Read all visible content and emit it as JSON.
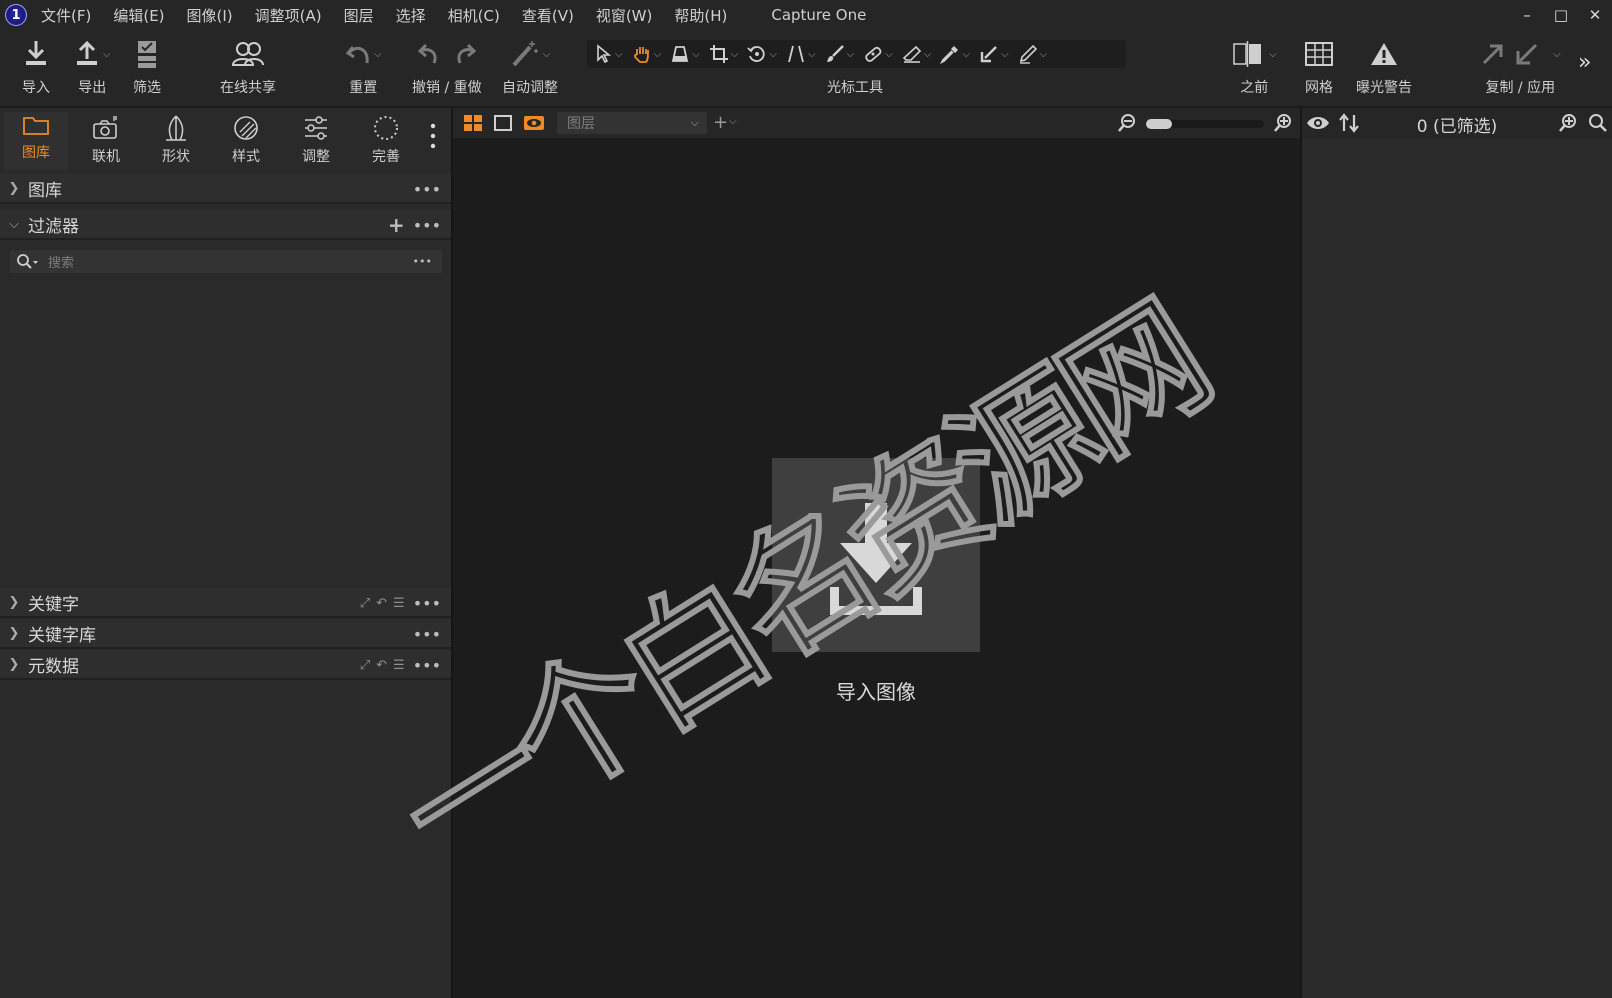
{
  "window": {
    "title": "Capture One",
    "logo_char": "1",
    "controls": {
      "minimize": "–",
      "maximize": "□",
      "close": "✕"
    }
  },
  "menu": [
    "文件(F)",
    "编辑(E)",
    "图像(I)",
    "调整项(A)",
    "图层",
    "选择",
    "相机(C)",
    "查看(V)",
    "视窗(W)",
    "帮助(H)"
  ],
  "toolbar": {
    "import": "导入",
    "export": "导出",
    "filter": "筛选",
    "share": "在线共享",
    "reset": "重置",
    "undo_redo": "撤销 / 重做",
    "auto_adjust": "自动调整",
    "cursor_tools": "光标工具",
    "before": "之前",
    "grid": "网格",
    "exposure_warning": "曝光警告",
    "copy_apply": "复制 / 应用",
    "more": "»"
  },
  "tool_tabs": [
    {
      "label": "图库",
      "icon": "folder-icon",
      "active": true
    },
    {
      "label": "联机",
      "icon": "camera-icon",
      "active": false
    },
    {
      "label": "形状",
      "icon": "lens-shape-icon",
      "active": false
    },
    {
      "label": "样式",
      "icon": "styles-icon",
      "active": false
    },
    {
      "label": "调整",
      "icon": "sliders-icon",
      "active": false
    },
    {
      "label": "完善",
      "icon": "refine-icon",
      "active": false
    }
  ],
  "sections": {
    "library": "图库",
    "filters": "过滤器",
    "keywords": "关键字",
    "keyword_library": "关键字库",
    "metadata": "元数据"
  },
  "search": {
    "placeholder": "搜索",
    "more": "•••"
  },
  "viewer": {
    "layer_select": "图层",
    "add_layer": "+",
    "import_label": "导入图像"
  },
  "browser": {
    "count_label": "0 (已筛选)"
  },
  "watermark": [
    "一",
    "个",
    "白",
    "名",
    "资",
    "源",
    "网"
  ],
  "colors": {
    "accent": "#f08a24",
    "bg_dark": "#1c1c1c",
    "panel": "#2a2a2a",
    "toolbar": "#262626"
  }
}
